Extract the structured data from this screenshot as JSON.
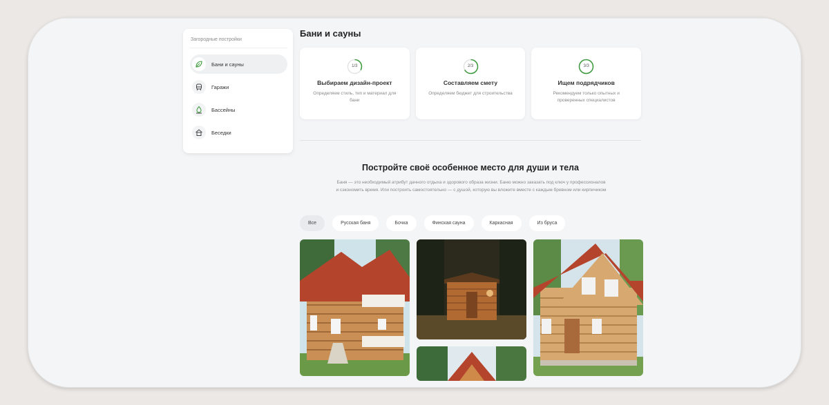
{
  "sidebar": {
    "title": "Загородные постройки",
    "items": [
      {
        "label": "Бани и сауны",
        "icon": "leaf-icon",
        "active": true
      },
      {
        "label": "Гаражи",
        "icon": "car-icon",
        "active": false
      },
      {
        "label": "Бассейны",
        "icon": "drop-icon",
        "active": false
      },
      {
        "label": "Беседки",
        "icon": "house-icon",
        "active": false
      }
    ]
  },
  "page": {
    "title": "Бани и сауны"
  },
  "steps": [
    {
      "counter": "1/3",
      "progress": 0.333,
      "title": "Выбираем дизайн-проект",
      "text": "Определяем стиль, тип и материал для бани"
    },
    {
      "counter": "2/3",
      "progress": 0.667,
      "title": "Составляем смету",
      "text": "Определяем бюджет для строительства"
    },
    {
      "counter": "3/3",
      "progress": 1.0,
      "title": "Ищем подрядчиков",
      "text": "Рекомендуем только опытных и проверенных специалистов"
    }
  ],
  "hero": {
    "title": "Постройте своё особенное место для души и тела",
    "text": "Баня — это необходимый атрибут дачного отдыха и здорового образа жизни. Баню можно заказать под ключ у профессионалов и сэкономить время. Или построить самостоятельно — с душой, которую вы вложите вместе с каждым бревном или кирпичиком"
  },
  "filters": [
    {
      "label": "Все",
      "active": true
    },
    {
      "label": "Русская баня",
      "active": false
    },
    {
      "label": "Бочка",
      "active": false
    },
    {
      "label": "Финская сауна",
      "active": false
    },
    {
      "label": "Каркасная",
      "active": false
    },
    {
      "label": "Из бруса",
      "active": false
    }
  ],
  "colors": {
    "accent": "#3c9a3c",
    "ring_track": "#e4e4e4"
  }
}
